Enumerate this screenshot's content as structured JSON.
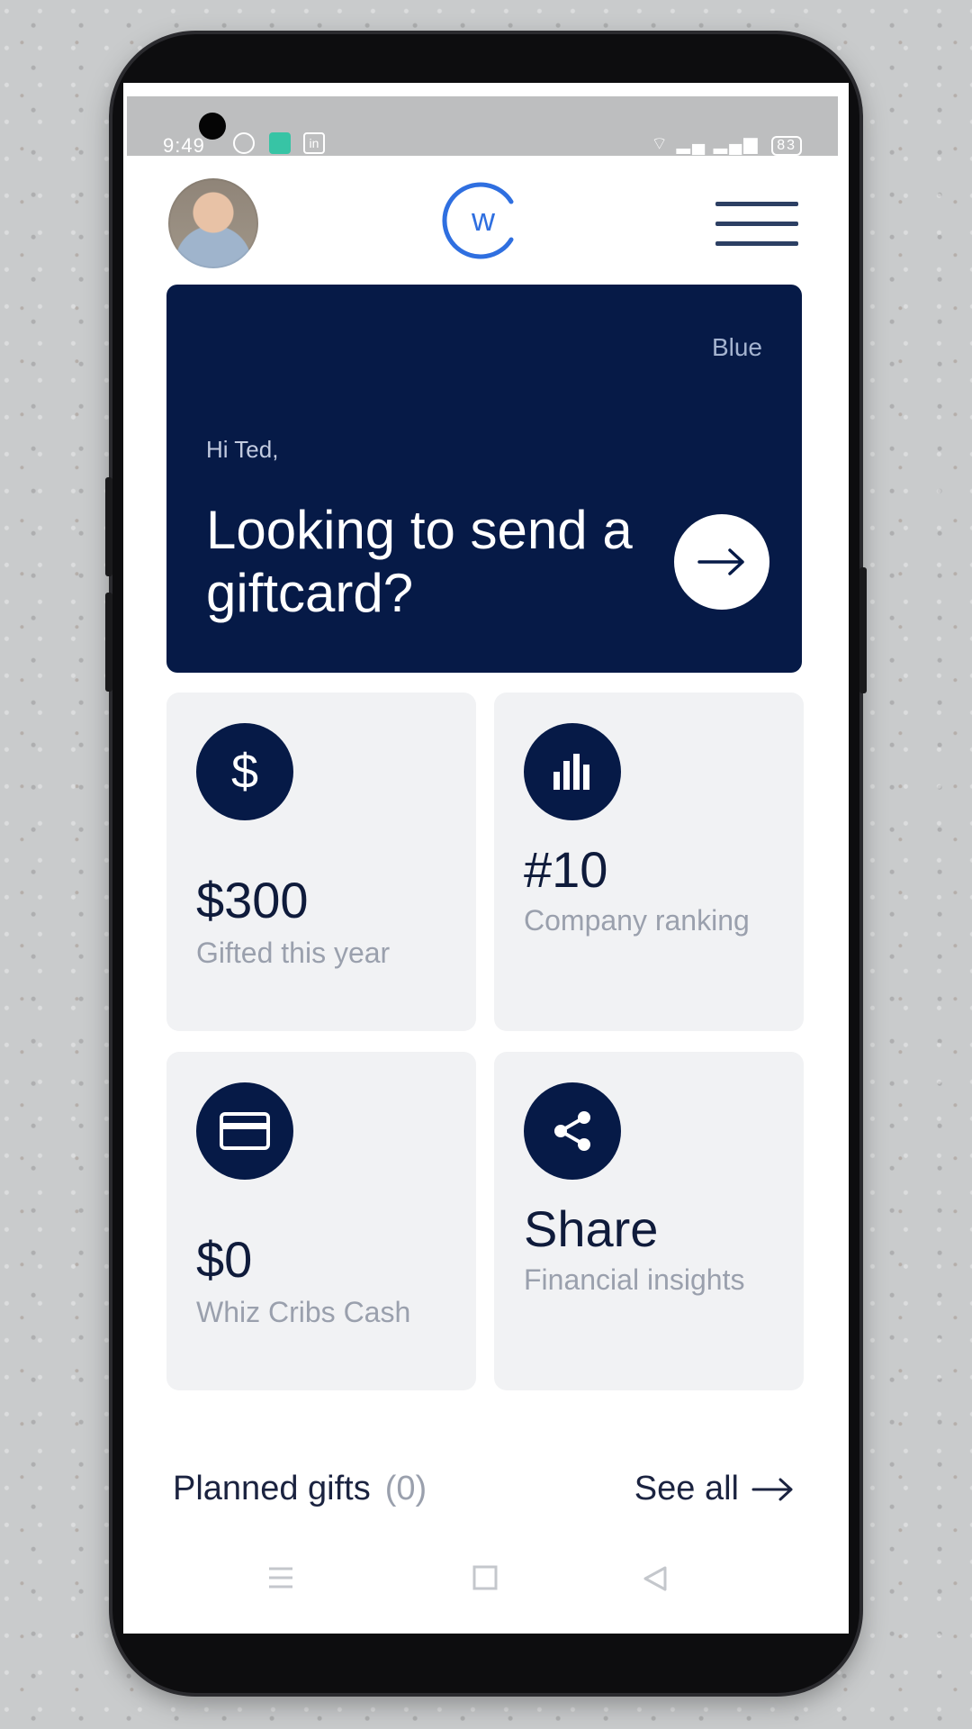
{
  "status_bar": {
    "time": "9:49",
    "icons": [
      "whatsapp-icon",
      "app-icon",
      "linkedin-icon"
    ],
    "signal_icons": [
      "wifi-icon",
      "signal-icon",
      "signal-icon"
    ],
    "battery": "83"
  },
  "header": {
    "avatar": "profile-avatar",
    "logo_letter": "w",
    "menu_icon": "hamburger-menu-icon"
  },
  "hero": {
    "badge": "Blue",
    "greeting": "Hi Ted,",
    "title": "Looking to send a giftcard?",
    "cta_icon": "arrow-right-icon"
  },
  "tiles": [
    {
      "icon": "dollar-icon",
      "value": "$300",
      "label": "Gifted this year"
    },
    {
      "icon": "bar-chart-icon",
      "value": "#10",
      "label": "Company ranking"
    },
    {
      "icon": "credit-card-icon",
      "value": "$0",
      "label": "Whiz Cribs Cash"
    },
    {
      "icon": "share-icon",
      "value": "Share",
      "label": "Financial insights"
    }
  ],
  "planned": {
    "title": "Planned gifts",
    "count": "(0)",
    "see_all": "See all"
  },
  "nav": {
    "items": [
      "menu-nav-icon",
      "home-nav-icon",
      "back-nav-icon"
    ]
  },
  "colors": {
    "navy": "#061a47",
    "tile_bg": "#f1f2f4",
    "logo_blue": "#2f6fe0"
  }
}
